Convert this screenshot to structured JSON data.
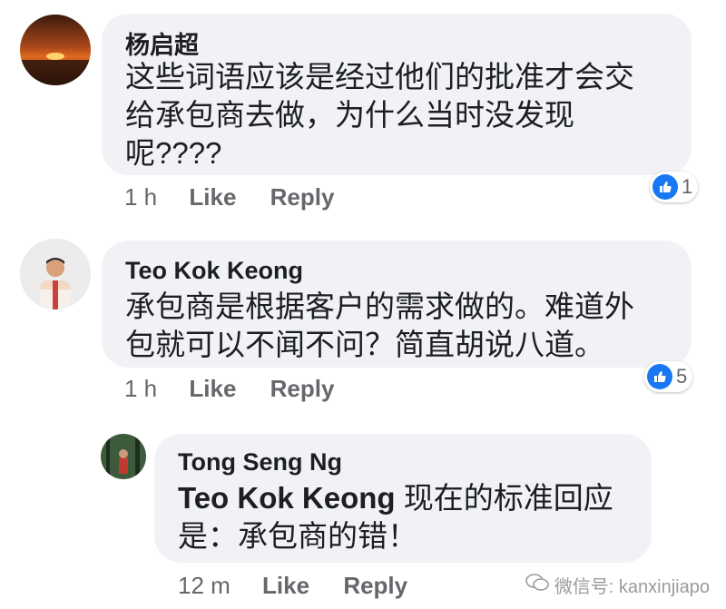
{
  "comments": [
    {
      "author": "杨启超",
      "text": "这些词语应该是经过他们的批准才会交\n给承包商去做，为什么当时没发现\n呢????",
      "time": "1 h",
      "like_label": "Like",
      "reply_label": "Reply",
      "reaction_count": "1"
    },
    {
      "author": "Teo Kok Keong",
      "text": "承包商是根据客户的需求做的。难道外\n包就可以不闻不问？简直胡说八道。",
      "time": "1 h",
      "like_label": "Like",
      "reply_label": "Reply",
      "reaction_count": "5"
    }
  ],
  "reply": {
    "author": "Tong Seng Ng",
    "mention": "Teo Kok Keong",
    "text_after_mention": " 现在的标准回应\n是：承包商的错！",
    "time": "12 m",
    "like_label": "Like",
    "reply_label": "Reply"
  },
  "watermark": "微信号: kanxinjiapo",
  "colors": {
    "bubble": "#f0f2f5",
    "like_blue": "#1877f2",
    "meta": "#65676b"
  }
}
